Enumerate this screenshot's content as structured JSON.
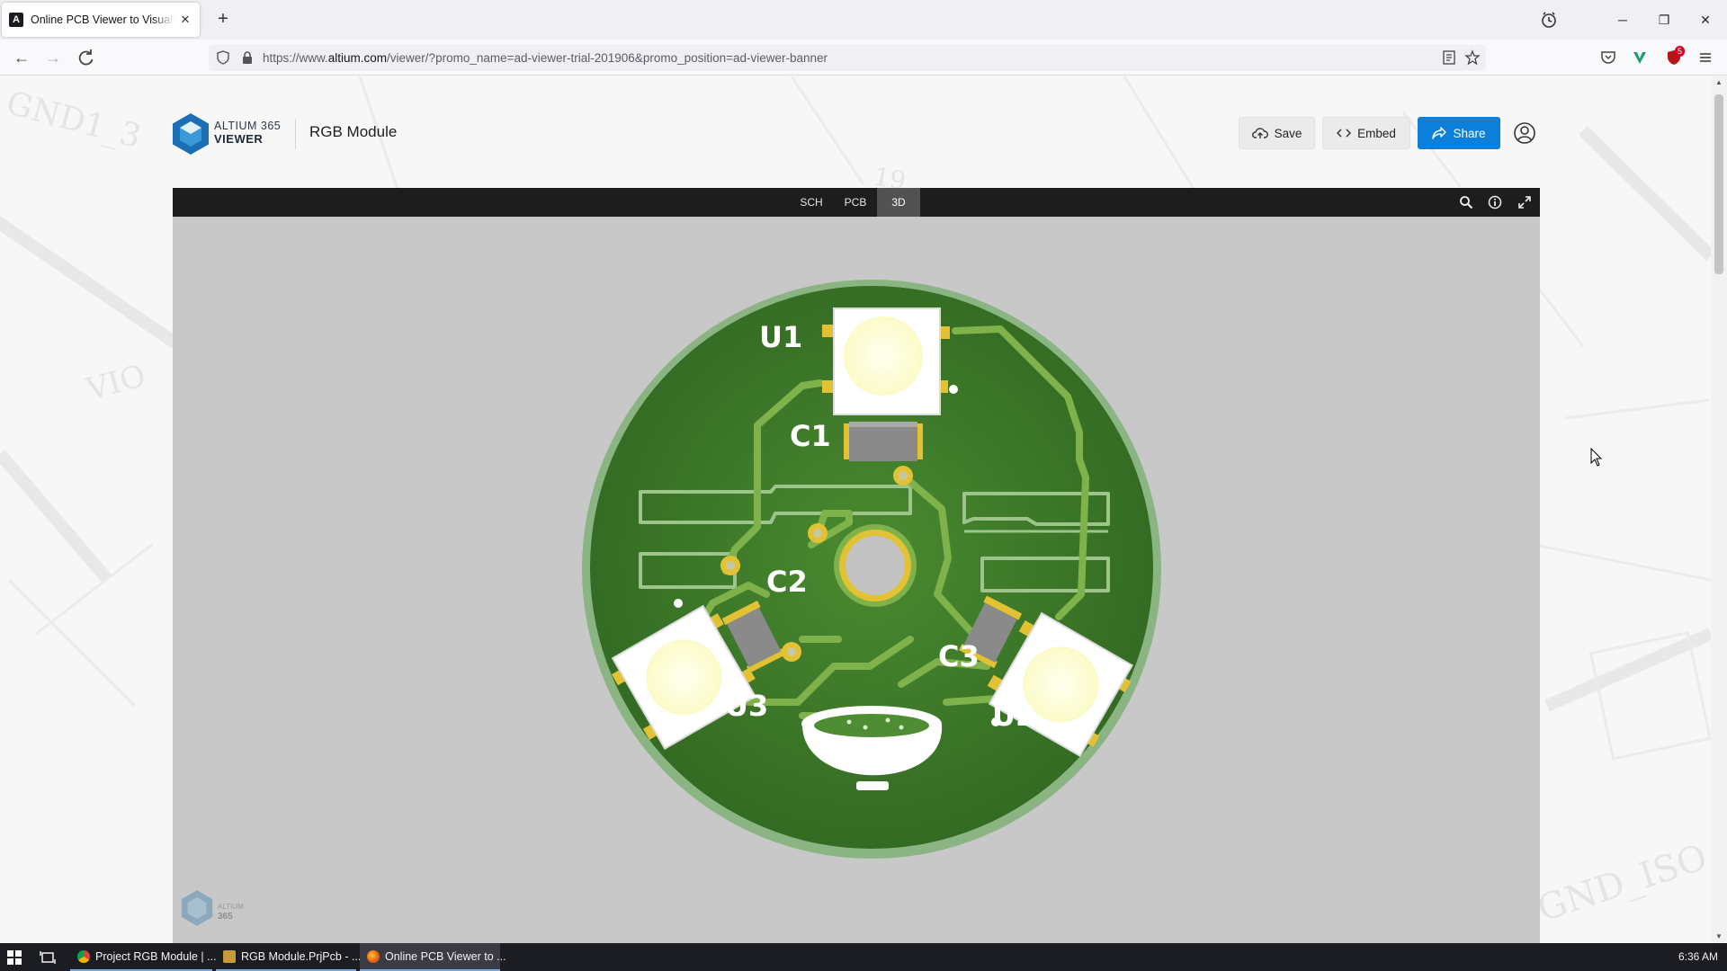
{
  "browser": {
    "tab_title": "Online PCB Viewer to Visualize",
    "tab_favicon_letter": "A",
    "tab_close": "✕",
    "new_tab": "+",
    "url_prefix": "https://www.",
    "url_domain": "altium.com",
    "url_rest": "/viewer/?promo_name=ad-viewer-trial-201906&promo_position=ad-viewer-banner",
    "extension_badge": "5",
    "window_controls": {
      "minimize": "─",
      "restore": "❐",
      "close": "✕"
    }
  },
  "header": {
    "brand_top": "ALTIUM 365",
    "brand_bottom": "VIEWER",
    "project_title": "RGB Module",
    "save_label": "Save",
    "embed_label": "Embed",
    "share_label": "Share"
  },
  "viewer": {
    "tabs": [
      {
        "label": "SCH",
        "active": false
      },
      {
        "label": "PCB",
        "active": false
      },
      {
        "label": "3D",
        "active": true
      }
    ],
    "designators": [
      "U1",
      "C1",
      "C2",
      "C3",
      "U3",
      "U2"
    ],
    "watermark_top": "ALTIUM",
    "watermark_bottom": "365"
  },
  "background_text": [
    "GND1_3",
    "VIO",
    "19",
    "GND_ISO"
  ],
  "taskbar": {
    "items": [
      {
        "label": "Project RGB Module | ...",
        "active": false
      },
      {
        "label": "RGB Module.PrjPcb - ...",
        "active": false
      },
      {
        "label": "Online PCB Viewer to ...",
        "active": true
      }
    ],
    "clock": "6:36 AM"
  },
  "colors": {
    "share_button": "#0b7fd9",
    "pcb_green": "#3f7a2a",
    "trace_green": "#7fb24a",
    "pad_gold": "#e2c233",
    "viewer_bar": "#1d1d1d",
    "active_tab": "#525252"
  }
}
